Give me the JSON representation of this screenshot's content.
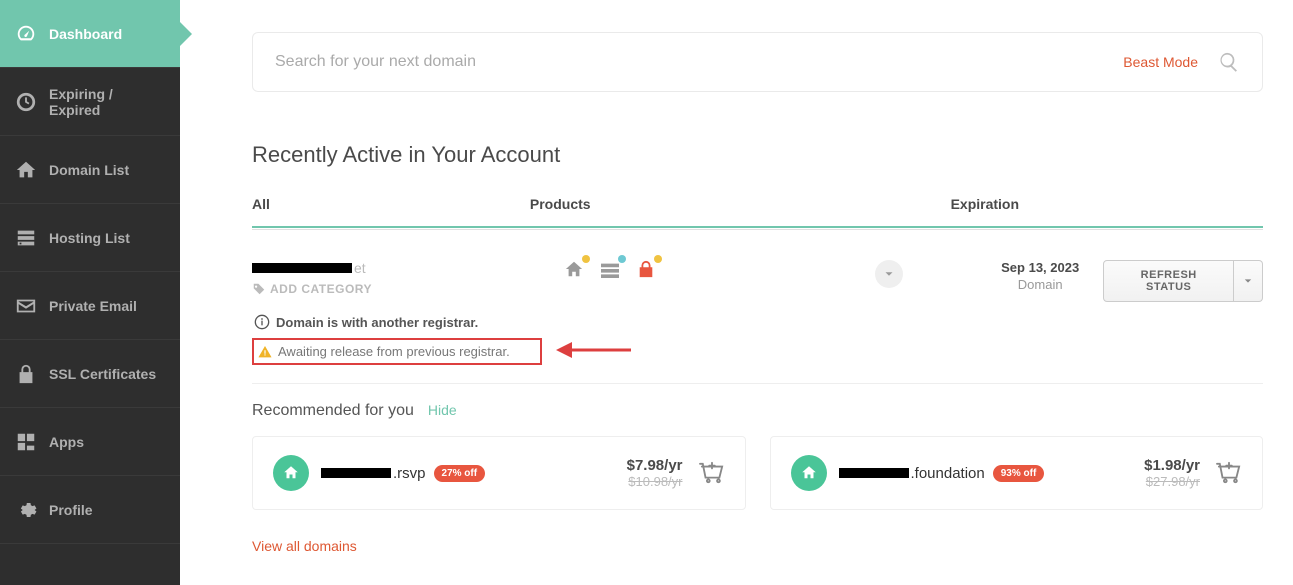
{
  "sidebar": {
    "items": [
      {
        "label": "Dashboard",
        "icon": "gauge-icon"
      },
      {
        "label": "Expiring / Expired",
        "icon": "clock-icon"
      },
      {
        "label": "Domain List",
        "icon": "home-icon"
      },
      {
        "label": "Hosting List",
        "icon": "server-icon"
      },
      {
        "label": "Private Email",
        "icon": "mail-icon"
      },
      {
        "label": "SSL Certificates",
        "icon": "lock-icon"
      },
      {
        "label": "Apps",
        "icon": "apps-icon"
      },
      {
        "label": "Profile",
        "icon": "gear-icon"
      }
    ]
  },
  "search": {
    "placeholder": "Search for your next domain",
    "beast_mode": "Beast Mode"
  },
  "section": {
    "title": "Recently Active in Your Account",
    "tabs": {
      "all": "All",
      "products": "Products",
      "expiration": "Expiration"
    }
  },
  "domain": {
    "tld": "et",
    "add_category": "ADD CATEGORY",
    "status1": "Domain is with another registrar.",
    "status2": "Awaiting release from previous registrar.",
    "expiration_date": "Sep 13, 2023",
    "expiration_type": "Domain",
    "refresh": "REFRESH STATUS"
  },
  "recommended": {
    "title": "Recommended for you",
    "hide": "Hide",
    "cards": [
      {
        "tld": ".rsvp",
        "discount": "27% off",
        "price": "$7.98/yr",
        "orig": "$10.98/yr"
      },
      {
        "tld": ".foundation",
        "discount": "93% off",
        "price": "$1.98/yr",
        "orig": "$27.98/yr"
      }
    ]
  },
  "view_all": "View all domains"
}
